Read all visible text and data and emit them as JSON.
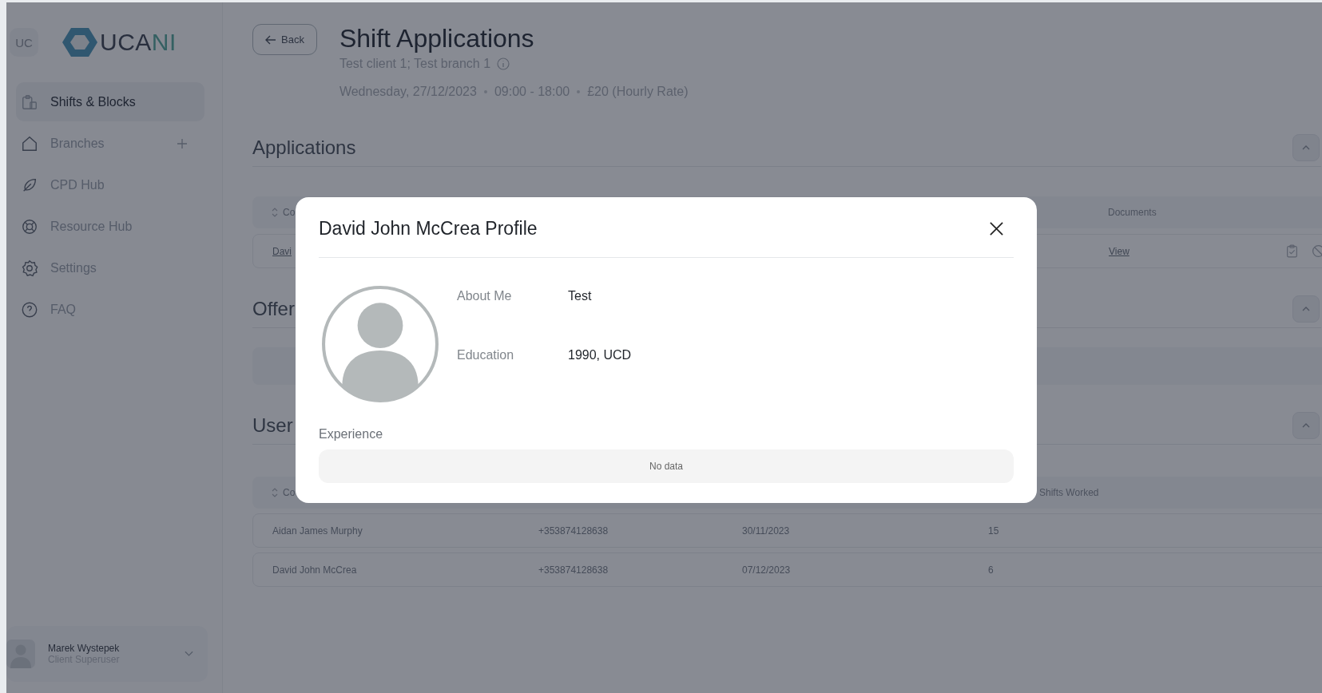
{
  "sidebar": {
    "badge": "UC",
    "logo": {
      "main": "UCA",
      "accent": "NI"
    },
    "nav": [
      {
        "label": "Shifts & Blocks",
        "selected": true,
        "addable": false
      },
      {
        "label": "Branches",
        "selected": false,
        "addable": true
      },
      {
        "label": "CPD Hub",
        "selected": false,
        "addable": false
      },
      {
        "label": "Resource Hub",
        "selected": false,
        "addable": false
      },
      {
        "label": "Settings",
        "selected": false,
        "addable": false
      },
      {
        "label": "FAQ",
        "selected": false,
        "addable": false
      }
    ],
    "user": {
      "name": "Marek Wystepek",
      "role": "Client Superuser"
    }
  },
  "header": {
    "back": "Back",
    "title": "Shift Applications",
    "subtitle": "Test client 1; Test branch 1",
    "meta": [
      "Wednesday, 27/12/2023",
      "09:00 - 18:00",
      "£20 (Hourly Rate)"
    ]
  },
  "sections": [
    {
      "kind": "applications",
      "title": "Applications",
      "expanded": true,
      "columns": [
        "Co",
        "Documents"
      ],
      "rows": [
        {
          "cells": [
            "Davi",
            "View"
          ]
        }
      ]
    },
    {
      "kind": "empty",
      "title": "Offer",
      "expanded": true
    },
    {
      "kind": "users",
      "title": "User",
      "expanded": true,
      "columns": [
        "Co",
        "Shifts Worked"
      ],
      "rows": [
        {
          "cells": [
            "Aidan James Murphy",
            "+353874128638",
            "30/11/2023",
            "15"
          ]
        },
        {
          "cells": [
            "David John McCrea",
            "+353874128638",
            "07/12/2023",
            "6"
          ]
        }
      ]
    }
  ],
  "modal": {
    "title": "David John McCrea Profile",
    "fields": [
      {
        "label": "About Me",
        "value": "Test"
      },
      {
        "label": "Education",
        "value": "1990, UCD"
      }
    ],
    "experience_label": "Experience",
    "experience_empty": "No data"
  }
}
